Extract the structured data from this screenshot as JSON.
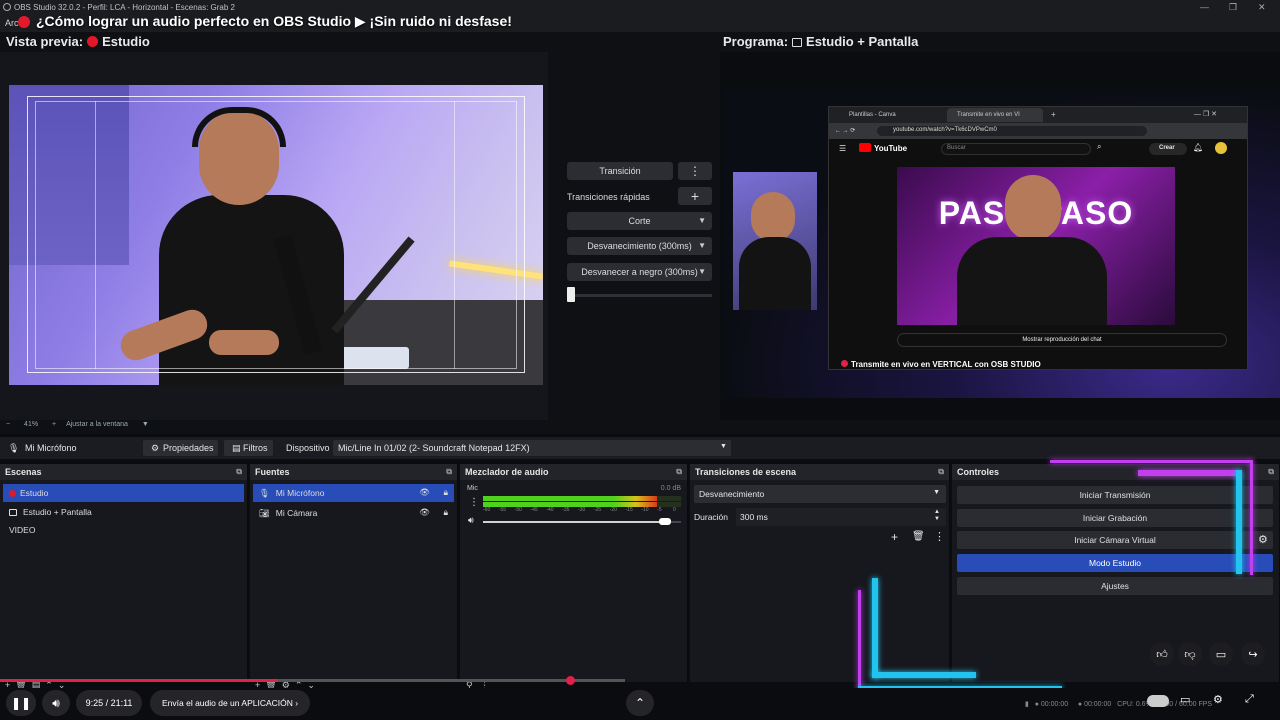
{
  "window": {
    "title": "OBS Studio 32.0.2 - Perfil: LCA - Horizontal - Escenas: Grab 2",
    "menu_first": "Arc"
  },
  "video_overlay": {
    "title": "¿Cómo lograr un audio perfecto en OBS Studio ▶ ¡Sin ruido ni desfase!"
  },
  "preview": {
    "label": "Vista previa:",
    "scene": "Estudio",
    "zoom_text": "41%",
    "fit_text": "Ajustar a la ventana"
  },
  "program": {
    "label": "Programa:",
    "scene": "Estudio  + Pantalla"
  },
  "transitions_mid": {
    "transition_button": "Transición",
    "quick_label": "Transiciones rápidas",
    "items": [
      "Corte",
      "Desvanecimiento (300ms)",
      "Desvanecer a negro (300ms)"
    ]
  },
  "browser": {
    "tab1": "Plantillas - Canva",
    "tab2": "Transmite en vivo en VI",
    "url": "youtube.com/watch?v=Tk6cDVPwCm0",
    "search": "Buscar",
    "create": "Crear",
    "video_text": "PASO   PASO",
    "chat_btn": "Mostrar reproducción del chat",
    "video_title": "Transmite en vivo en VERTICAL con OSB STUDIO"
  },
  "source_bar": {
    "source": "Mi Micrófono",
    "properties": "Propiedades",
    "filters": "Filtros",
    "device_label": "Dispositivo",
    "device_value": "Mic/Line In 01/02 (2- Soundcraft Notepad 12FX)"
  },
  "scenes": {
    "title": "Escenas",
    "items": [
      "Estudio",
      "Estudio  + Pantalla",
      "VIDEO"
    ]
  },
  "sources": {
    "title": "Fuentes",
    "items": [
      "Mi Micrófono",
      "Mi Cámara"
    ]
  },
  "mixer": {
    "title": "Mezclador de audio",
    "channel": "Mic",
    "level": "0.0 dB",
    "ticks": [
      "-60",
      "-55",
      "-50",
      "-45",
      "-40",
      "-35",
      "-30",
      "-25",
      "-20",
      "-15",
      "-10",
      "-5",
      "0"
    ],
    "meter_level": 0.88,
    "volume": 0.92
  },
  "scene_transitions": {
    "title": "Transiciones de escena",
    "type": "Desvanecimiento",
    "duration_label": "Duración",
    "duration_value": "300 ms"
  },
  "controls": {
    "title": "Controles",
    "buttons": [
      "Iniciar Transmisión",
      "Iniciar Grabación",
      "Iniciar Cámara Virtual",
      "Modo Estudio",
      "Ajustes"
    ]
  },
  "player": {
    "time": "9:25 / 21:11",
    "chapter": "Envía el audio de un APLICACIÓN",
    "progress": 0.445,
    "status_time1": "00:00:00",
    "status_time2": "00:00:00",
    "cpu": "CPU: 0.6%",
    "fps": "60.00 / 60.00 FPS"
  },
  "colors": {
    "accent": "#284cb8",
    "record": "#e0182a",
    "progress": "#e0224a",
    "neon_cyan": "#22c3ef",
    "neon_magenta": "#c23ff0"
  }
}
